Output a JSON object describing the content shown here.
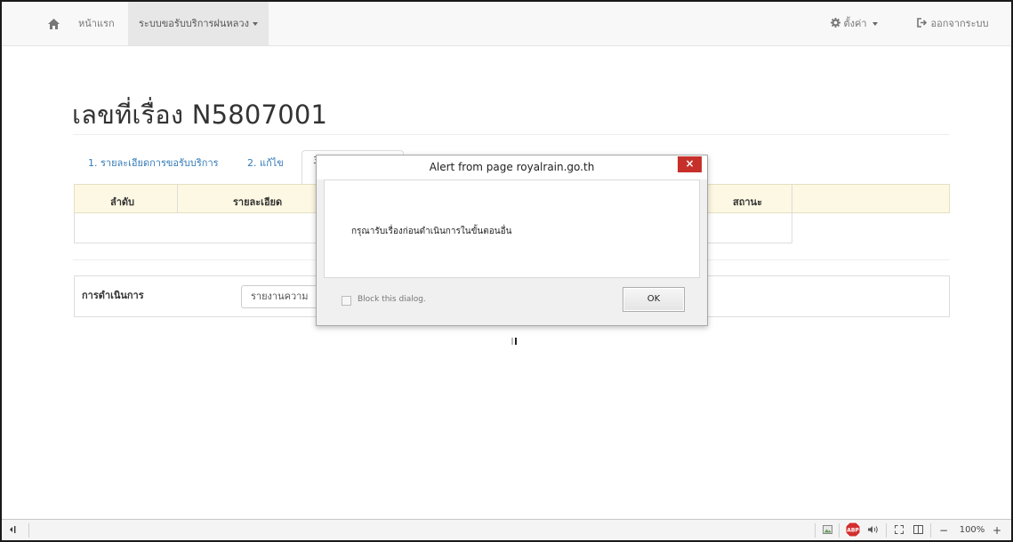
{
  "navbar": {
    "home_icon": "home-icon",
    "home_label": "หน้าแรก",
    "service_menu_label": "ระบบขอรับบริการฝนหลวง",
    "settings_icon": "gear-icon",
    "settings_label": "ตั้งค่า",
    "logout_icon": "logout-icon",
    "logout_label": "ออกจากระบบ"
  },
  "page": {
    "title": "เลขที่เรื่อง N5807001"
  },
  "tabs": [
    {
      "label": "1. รายละเอียดการขอรับบริการ"
    },
    {
      "label": "2. แก้ไข"
    },
    {
      "label": "3"
    }
  ],
  "table": {
    "columns": [
      "ลำดับ",
      "รายละเอียด",
      "สถานะ"
    ]
  },
  "action": {
    "label": "การดำเนินการ",
    "select_value": "รายงานความ"
  },
  "dialog": {
    "title": "Alert from page royalrain.go.th",
    "close_label": "×",
    "message": "กรุณารับเรื่องก่อนดำเนินการในขั้นตอนอื่น",
    "checkbox_label": "Block this dialog.",
    "ok_label": "OK"
  },
  "statusbar": {
    "left_icon": "devtools-icon",
    "abp_label": "ABP",
    "zoom_minus": "−",
    "zoom_level": "100%",
    "zoom_plus": "+"
  }
}
